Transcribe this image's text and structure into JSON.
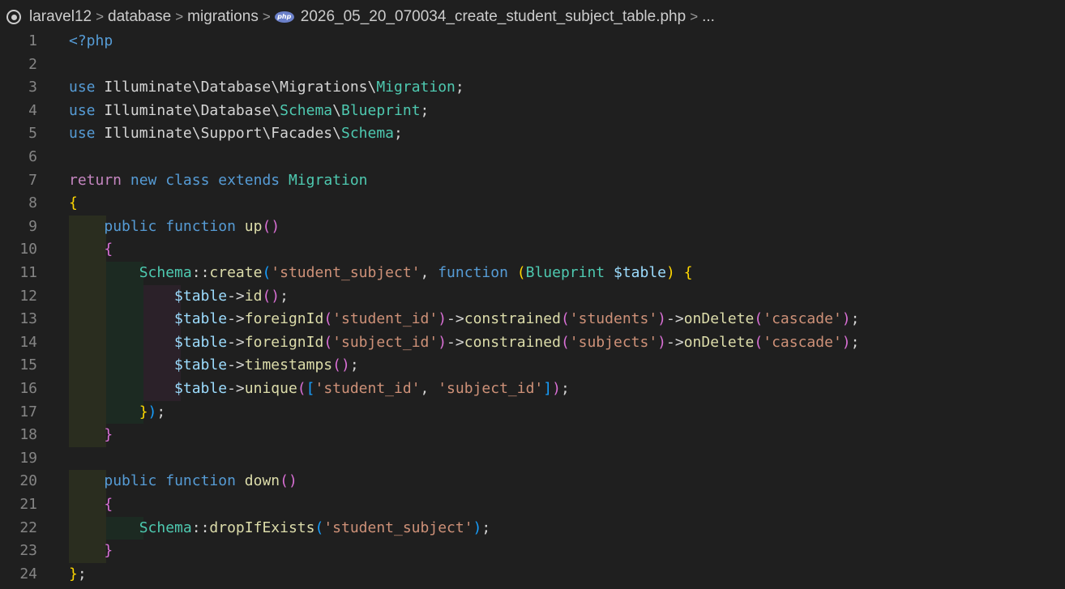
{
  "breadcrumb": {
    "items": [
      "laravel12",
      "database",
      "migrations"
    ],
    "file_icon_label": "php",
    "file_name": "2026_05_20_070034_create_student_subject_table.php",
    "ellipsis": "..."
  },
  "editor": {
    "language": "php",
    "line_numbers": [
      "1",
      "2",
      "3",
      "4",
      "5",
      "6",
      "7",
      "8",
      "9",
      "10",
      "11",
      "12",
      "13",
      "14",
      "15",
      "16",
      "17",
      "18",
      "19",
      "20",
      "21",
      "22",
      "23",
      "24"
    ],
    "lines": [
      "<?php",
      "",
      "use Illuminate\\Database\\Migrations\\Migration;",
      "use Illuminate\\Database\\Schema\\Blueprint;",
      "use Illuminate\\Support\\Facades\\Schema;",
      "",
      "return new class extends Migration",
      "{",
      "    public function up()",
      "    {",
      "        Schema::create('student_subject', function (Blueprint $table) {",
      "            $table->id();",
      "            $table->foreignId('student_id')->constrained('students')->onDelete('cascade');",
      "            $table->foreignId('subject_id')->constrained('subjects')->onDelete('cascade');",
      "            $table->timestamps();",
      "            $table->unique(['student_id', 'subject_id']);",
      "        });",
      "    }",
      "",
      "    public function down()",
      "    {",
      "        Schema::dropIfExists('student_subject');",
      "    }",
      "};"
    ]
  },
  "colors": {
    "background": "#1f1f1f",
    "line_number": "#858585",
    "keyword": "#569cd6",
    "control": "#c586c0",
    "class": "#4ec9b0",
    "function": "#dcdcaa",
    "string": "#ce9178",
    "variable": "#9cdcfe",
    "bracket_gold": "#ffd700",
    "bracket_orchid": "#da70d6",
    "bracket_blue": "#179fff"
  }
}
